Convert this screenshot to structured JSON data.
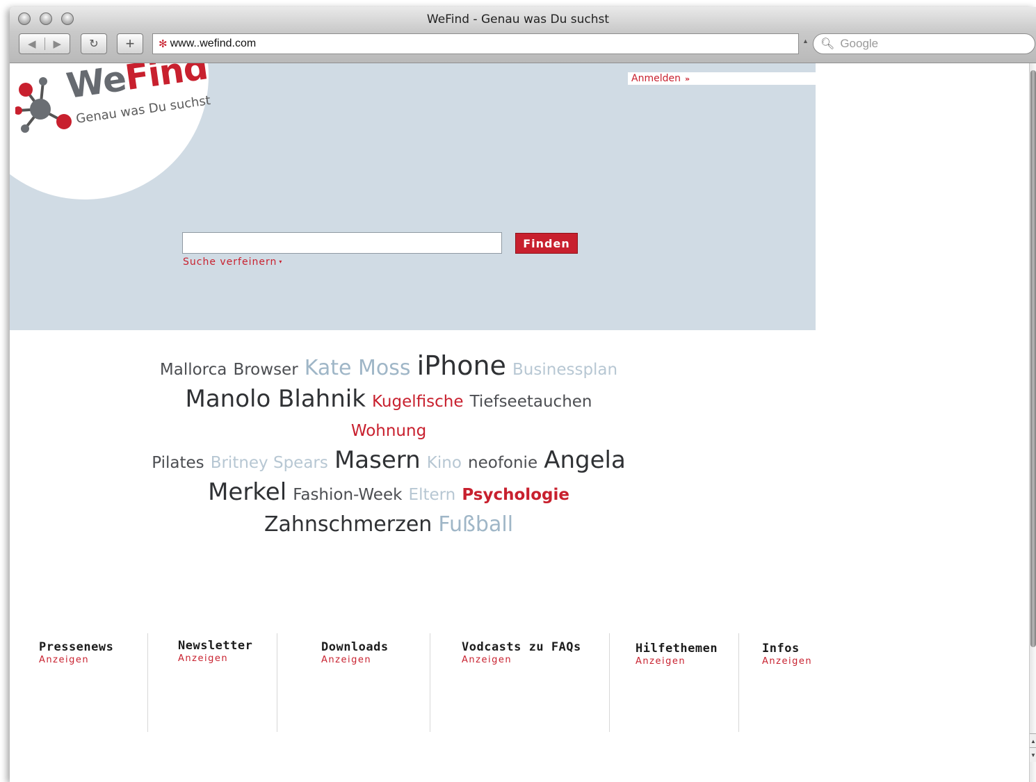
{
  "browser": {
    "window_title": "WeFind  - Genau was Du suchst",
    "url": "www..wefind.com",
    "search_placeholder": "Google",
    "back_icon": "back-arrow-icon",
    "forward_icon": "forward-arrow-icon",
    "reload_icon": "reload-icon",
    "add_icon": "plus-icon"
  },
  "header": {
    "logo_we": "We",
    "logo_find": "Find",
    "tagline": "Genau was Du suchst",
    "login_label": "Anmelden",
    "login_arrow": "»"
  },
  "search": {
    "input_value": "",
    "button_label": "Finden",
    "refine_label": "Suche verfeinern",
    "refine_caret": "▾"
  },
  "tag_cloud": [
    {
      "text": "Mallorca",
      "style": "t-mid s2"
    },
    {
      "text": "Browser",
      "style": "t-mid s2"
    },
    {
      "text": "Kate Moss",
      "style": "t-light s3"
    },
    {
      "text": "iPhone",
      "style": "t-dark s5"
    },
    {
      "text": "Businessplan",
      "style": "t-pale s2"
    },
    {
      "text": "Manolo Blahnik",
      "style": "t-dark s4"
    },
    {
      "text": "Kugelfische",
      "style": "t-red s2"
    },
    {
      "text": "Tiefseetauchen",
      "style": "t-mid s2"
    },
    {
      "text": "Wohnung",
      "style": "t-red s2"
    },
    {
      "text": "Pilates",
      "style": "t-mid s2"
    },
    {
      "text": "Britney Spears",
      "style": "t-pale s2"
    },
    {
      "text": "Masern",
      "style": "t-dark s4"
    },
    {
      "text": "Kino",
      "style": "t-pale s2"
    },
    {
      "text": "neofonie",
      "style": "t-mid s2"
    },
    {
      "text": "Angela",
      "style": "t-dark s4"
    },
    {
      "text": "Merkel",
      "style": "t-dark s4"
    },
    {
      "text": "Fashion-Week",
      "style": "t-mid s2"
    },
    {
      "text": "Eltern",
      "style": "t-pale s2"
    },
    {
      "text": "Psychologie",
      "style": "t-redb s2"
    },
    {
      "text": "Zahnschmerzen",
      "style": "t-dark s3"
    },
    {
      "text": "Fußball",
      "style": "t-light s3"
    }
  ],
  "footer": [
    {
      "title": "Pressenews",
      "link": "Anzeigen"
    },
    {
      "title": "Newsletter",
      "link": "Anzeigen"
    },
    {
      "title": "Downloads",
      "link": "Anzeigen"
    },
    {
      "title": "Vodcasts zu FAQs",
      "link": "Anzeigen"
    },
    {
      "title": "Hilfethemen",
      "link": "Anzeigen"
    },
    {
      "title": "Infos",
      "link": "Anzeigen"
    }
  ],
  "colors": {
    "brand_red": "#c8202e",
    "header_band": "#d0dbe4",
    "logo_gray": "#666a70"
  }
}
